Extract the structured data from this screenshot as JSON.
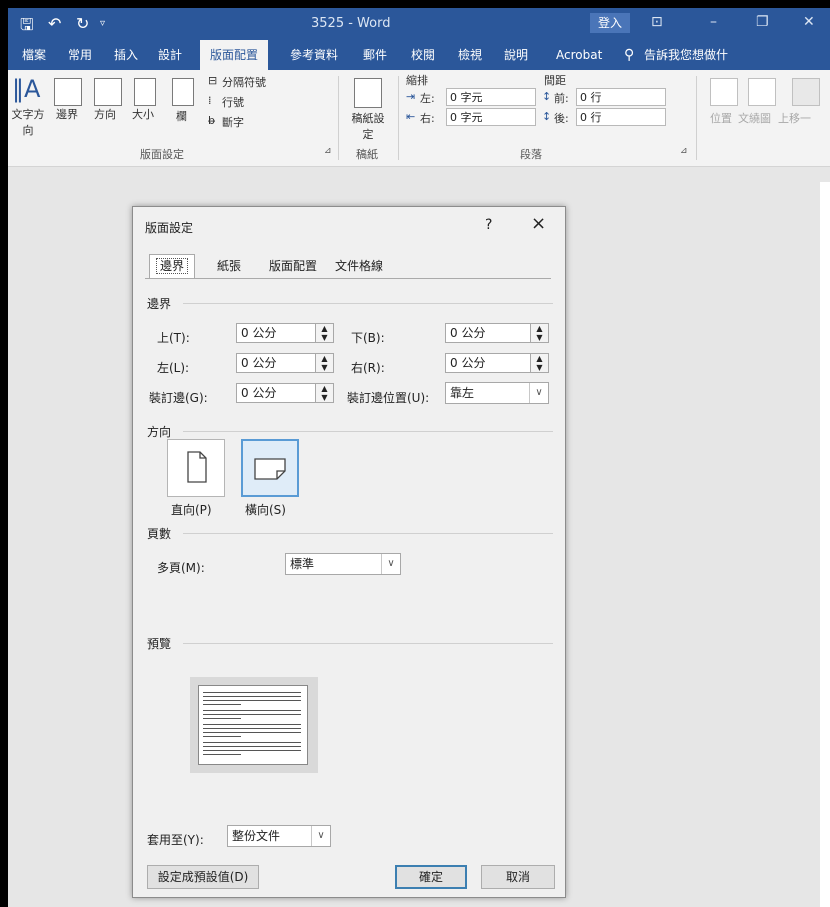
{
  "titlebar": {
    "doc_title": "3525 - Word",
    "signin": "登入",
    "ribbon_display_icon": "ribbon-display-icon",
    "minimize_icon": "minimize-icon",
    "restore_icon": "restore-icon",
    "close_icon": "close-icon"
  },
  "tabs": [
    "檔案",
    "常用",
    "插入",
    "設計",
    "版面配置",
    "參考資料",
    "郵件",
    "校閱",
    "檢視",
    "說明",
    "Acrobat"
  ],
  "active_tab": "版面配置",
  "tellme": "告訴我您想做什",
  "ribbon": {
    "text_direction": "文字方向",
    "margins": "邊界",
    "orientation": "方向",
    "size": "大小",
    "columns": "欄",
    "breaks": "分隔符號",
    "line_numbers": "行號",
    "hyphenation": "斷字",
    "group_page_setup": "版面設定",
    "draft": "稿紙設定",
    "group_draft": "稿紙",
    "indent_label": "縮排",
    "spacing_label": "間距",
    "indent_left_label": "左:",
    "indent_left_value": "0 字元",
    "indent_right_label": "右:",
    "indent_right_value": "0 字元",
    "space_before_label": "前:",
    "space_before_value": "0 行",
    "space_after_label": "後:",
    "space_after_value": "0 行",
    "group_paragraph": "段落",
    "position": "位置",
    "wrap_text": "文繞圖",
    "bring_forward": "上移一"
  },
  "dialog": {
    "title": "版面設定",
    "help": "?",
    "tabs": [
      "邊界",
      "紙張",
      "版面配置",
      "文件格線"
    ],
    "margins_group": "邊界",
    "top_label": "上(T):",
    "top_value": "0 公分",
    "bottom_label": "下(B):",
    "bottom_value": "0 公分",
    "left_label": "左(L):",
    "left_value": "0 公分",
    "right_label": "右(R):",
    "right_value": "0 公分",
    "gutter_label": "裝訂邊(G):",
    "gutter_value": "0 公分",
    "gutter_pos_label": "裝訂邊位置(U):",
    "gutter_pos_value": "靠左",
    "orientation_group": "方向",
    "portrait": "直向(P)",
    "landscape": "橫向(S)",
    "pages_group": "頁數",
    "multiple_pages_label": "多頁(M):",
    "multiple_pages_value": "標準",
    "preview_group": "預覽",
    "apply_to_label": "套用至(Y):",
    "apply_to_value": "整份文件",
    "set_default": "設定成預設值(D)",
    "ok": "確定",
    "cancel": "取消"
  }
}
